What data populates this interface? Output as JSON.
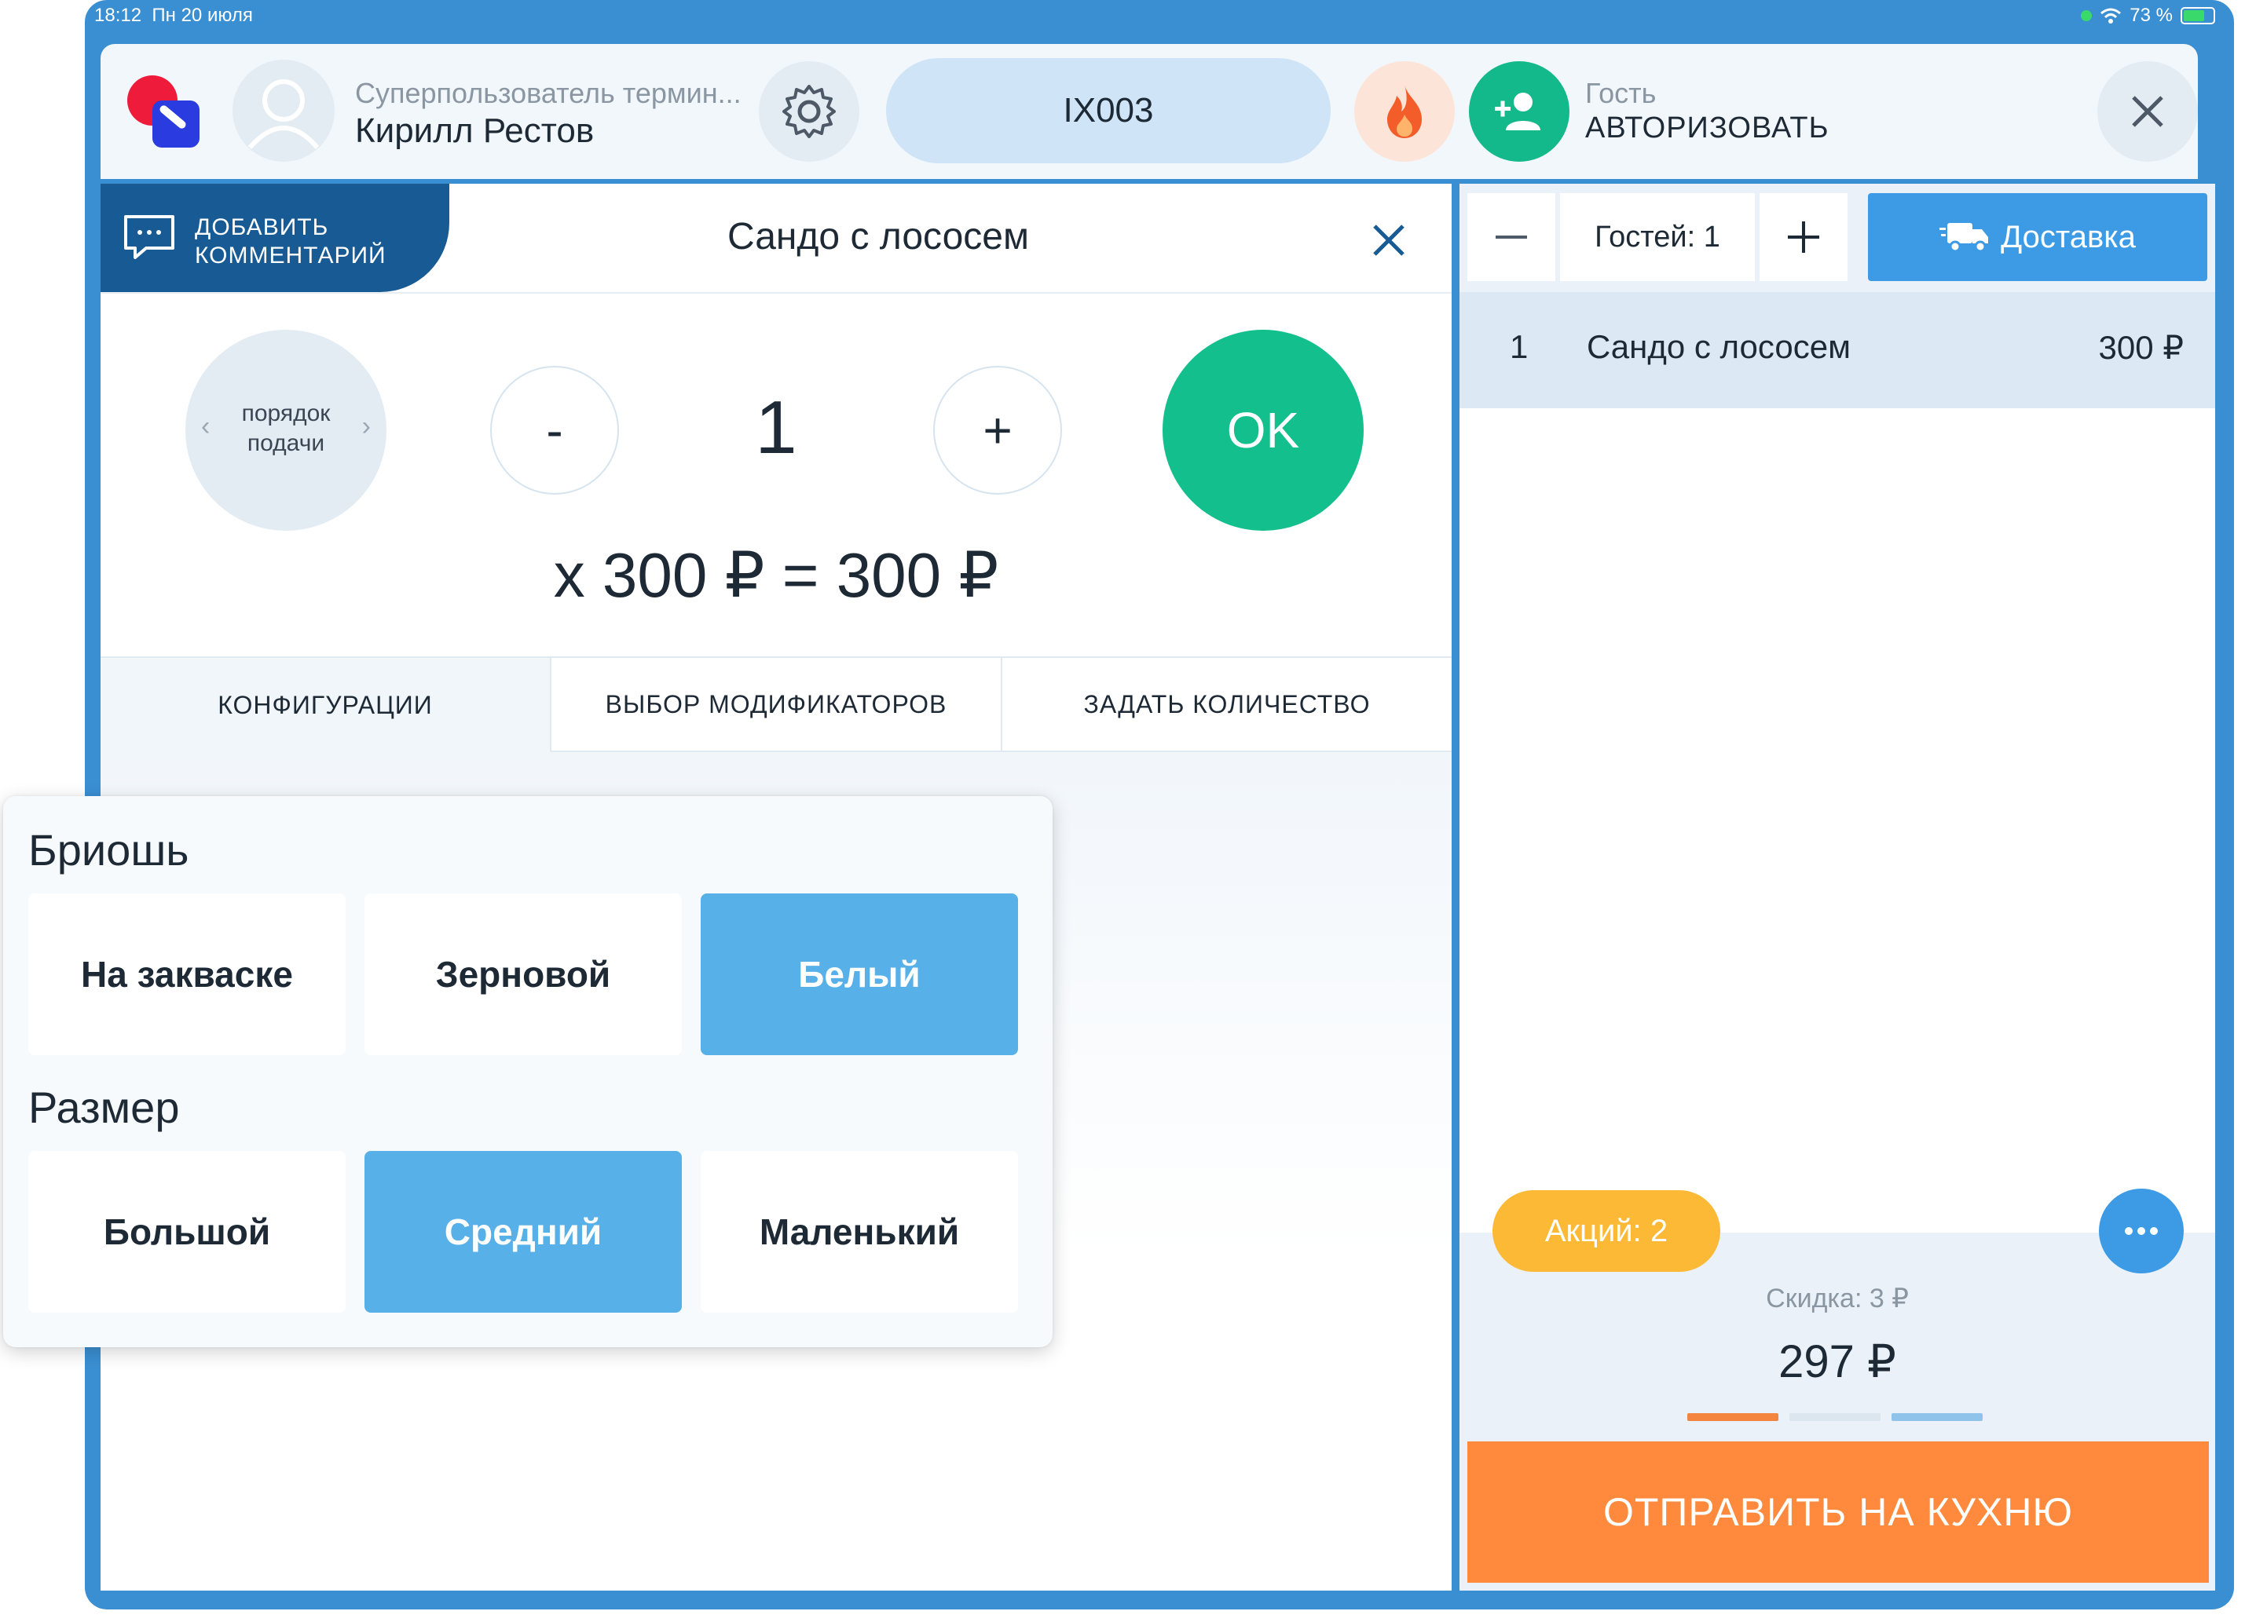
{
  "status_bar": {
    "time": "18:12",
    "date": "Пн 20 июля",
    "battery": "73 %"
  },
  "header": {
    "user_role": "Суперпользователь термин...",
    "user_name": "Кирилл Рестов",
    "table_label": "IX003",
    "guest_label": "Гость",
    "guest_action": "АВТОРИЗОВАТЬ",
    "icons": [
      "settings-gear-icon",
      "fire-icon",
      "add-guest-icon",
      "close-icon"
    ]
  },
  "dish_editor": {
    "comment_button": [
      "ДОБАВИТЬ",
      "КОММЕНТАРИЙ"
    ],
    "title": "Сандо с лососем",
    "course_label": [
      "порядок",
      "подачи"
    ],
    "minus": "-",
    "quantity": "1",
    "plus": "+",
    "ok": "OK",
    "price_line": "x 300 ₽ = 300 ₽",
    "tabs": [
      "КОНФИГУРАЦИИ",
      "ВЫБОР МОДИФИКАТОРОВ",
      "ЗАДАТЬ КОЛИЧЕСТВО"
    ],
    "active_tab": "КОНФИГУРАЦИИ"
  },
  "configurations": [
    {
      "title": "Бриошь",
      "options": [
        "На закваске",
        "Зерновой",
        "Белый"
      ],
      "selected": "Белый"
    },
    {
      "title": "Размер",
      "options": [
        "Большой",
        "Средний",
        "Маленький"
      ],
      "selected": "Средний"
    }
  ],
  "order": {
    "guests_label": "Гостей: 1",
    "delivery_label": "Доставка",
    "items": [
      {
        "num": "1",
        "name": "Сандо с лососем",
        "price": "300 ₽"
      }
    ],
    "promo_label": "Акций: 2",
    "discount_label": "Скидка: 3 ₽",
    "total": "297 ₽",
    "send_label": "ОТПРАВИТЬ НА КУХНЮ"
  },
  "colors": {
    "frame": "#3a8fd2",
    "ok_green": "#13bf8d",
    "selected_blue": "#58b0e8",
    "send_orange": "#ff8a3d",
    "promo_yellow": "#fbb935",
    "comment_navy": "#175a94"
  }
}
